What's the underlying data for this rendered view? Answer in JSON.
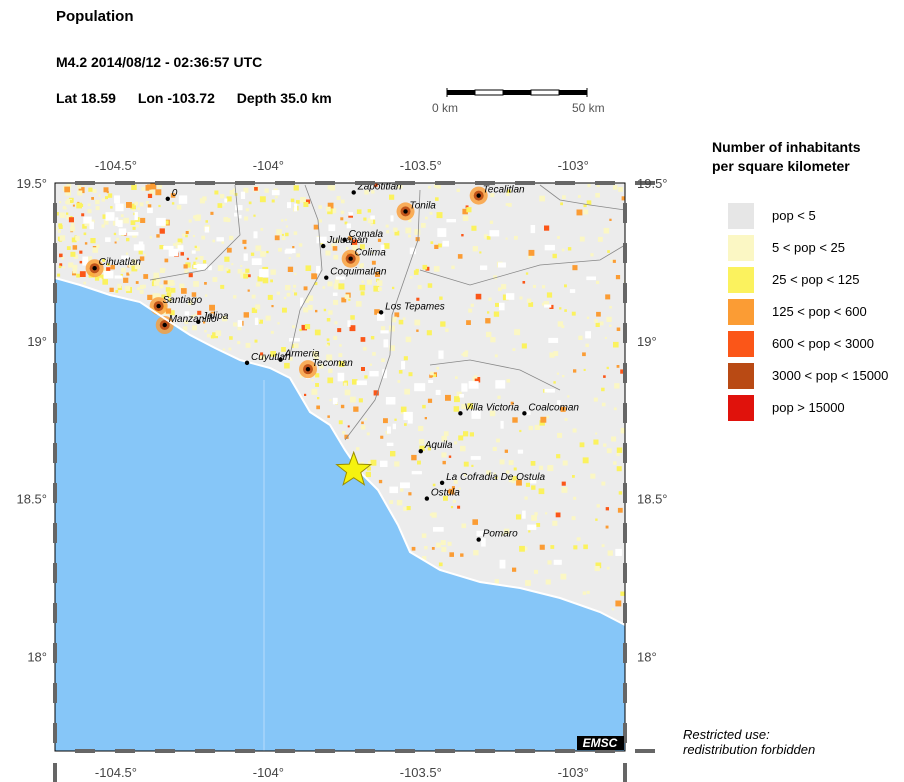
{
  "header": {
    "title": "Population",
    "event": "M4.2  2014/08/12 - 02:36:57 UTC",
    "lat": "Lat 18.59",
    "lon": "Lon -103.72",
    "depth": "Depth  35.0 km"
  },
  "scale": {
    "start_label": "0 km",
    "end_label": "50 km"
  },
  "legend": {
    "title_line1": "Number of inhabitants",
    "title_line2": "per square kilometer",
    "items": [
      {
        "label": "pop < 5",
        "color": "#e6e6e6"
      },
      {
        "label": "5 < pop < 25",
        "color": "#fbf7c4"
      },
      {
        "label": "25 < pop < 125",
        "color": "#fbf25e"
      },
      {
        "label": "125 < pop < 600",
        "color": "#fb9c34"
      },
      {
        "label": "600 < pop < 3000",
        "color": "#fb5618"
      },
      {
        "label": "3000 < pop < 15000",
        "color": "#b94a14"
      },
      {
        "label": "pop > 15000",
        "color": "#e0120c"
      }
    ]
  },
  "map": {
    "ocean_color": "#86c6f8",
    "lon_ticks": [
      {
        "value": -104.5,
        "label": "-104.5°"
      },
      {
        "value": -104.0,
        "label": "-104°"
      },
      {
        "value": -103.5,
        "label": "-103.5°"
      },
      {
        "value": -103.0,
        "label": "-103°"
      }
    ],
    "lat_ticks": [
      {
        "value": 19.5,
        "label": "19.5°"
      },
      {
        "value": 19.0,
        "label": "19°"
      },
      {
        "value": 18.5,
        "label": "18.5°"
      },
      {
        "value": 18.0,
        "label": "18°"
      }
    ],
    "epicenter": {
      "lat": 18.59,
      "lon": -103.72
    },
    "badge": "EMSC",
    "cities": [
      {
        "name": "0",
        "lat": 19.45,
        "lon": -104.33
      },
      {
        "name": "Zapotitlan",
        "lat": 19.47,
        "lon": -103.72
      },
      {
        "name": "Tecalitlan",
        "lat": 19.46,
        "lon": -103.31
      },
      {
        "name": "Tonila",
        "lat": 19.41,
        "lon": -103.55
      },
      {
        "name": "Comala",
        "lat": 19.32,
        "lon": -103.75
      },
      {
        "name": "Juluapan",
        "lat": 19.3,
        "lon": -103.82
      },
      {
        "name": "Colima",
        "lat": 19.26,
        "lon": -103.73
      },
      {
        "name": "Coquimatlan",
        "lat": 19.2,
        "lon": -103.81
      },
      {
        "name": "Cihuatlan",
        "lat": 19.23,
        "lon": -104.57
      },
      {
        "name": "Santiago",
        "lat": 19.11,
        "lon": -104.36
      },
      {
        "name": "Los Tepames",
        "lat": 19.09,
        "lon": -103.63
      },
      {
        "name": "Manzanillo",
        "lat": 19.05,
        "lon": -104.34
      },
      {
        "name": "Jalipa",
        "lat": 19.06,
        "lon": -104.23
      },
      {
        "name": "Cuyutlan",
        "lat": 18.93,
        "lon": -104.07
      },
      {
        "name": "Armeria",
        "lat": 18.94,
        "lon": -103.96
      },
      {
        "name": "Tecoman",
        "lat": 18.91,
        "lon": -103.87
      },
      {
        "name": "Villa Victoria",
        "lat": 18.77,
        "lon": -103.37
      },
      {
        "name": "Coalcoman",
        "lat": 18.77,
        "lon": -103.16
      },
      {
        "name": "Aquila",
        "lat": 18.65,
        "lon": -103.5
      },
      {
        "name": "La Cofradia De Ostula",
        "lat": 18.55,
        "lon": -103.43
      },
      {
        "name": "Ostula",
        "lat": 18.5,
        "lon": -103.48
      },
      {
        "name": "Pomaro",
        "lat": 18.37,
        "lon": -103.31
      }
    ]
  },
  "footer": {
    "line1": "Restricted use:",
    "line2": "redistribution forbidden"
  }
}
